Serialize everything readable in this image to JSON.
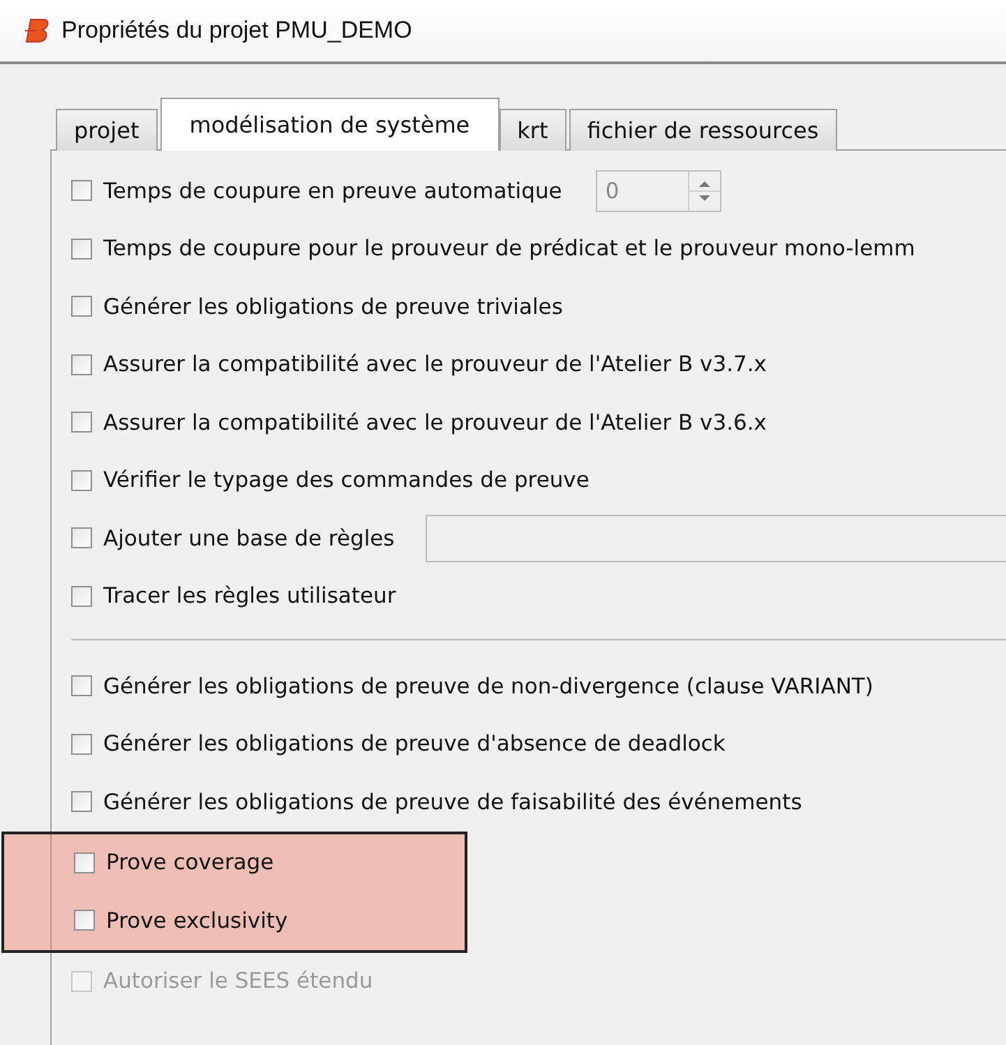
{
  "window": {
    "title": "Propriétés du projet PMU_DEMO"
  },
  "tabs": [
    {
      "label": "projet",
      "selected": false
    },
    {
      "label": "modélisation de système",
      "selected": true
    },
    {
      "label": "krt",
      "selected": false
    },
    {
      "label": "fichier de ressources",
      "selected": false
    }
  ],
  "groups": [
    {
      "options": [
        {
          "kind": "spinbox",
          "label": "Temps de coupure en preuve automatique",
          "checked": false,
          "disabled": false,
          "highlighted": false,
          "value": "0"
        },
        {
          "kind": "checkbox",
          "label": "Temps de coupure pour le prouveur de prédicat et le prouveur mono-lemm",
          "checked": false,
          "disabled": false,
          "highlighted": false
        },
        {
          "kind": "checkbox",
          "label": "Générer les obligations de preuve triviales",
          "checked": false,
          "disabled": false,
          "highlighted": false
        },
        {
          "kind": "checkbox",
          "label": "Assurer la compatibilité avec le prouveur de l'Atelier B v3.7.x",
          "checked": false,
          "disabled": false,
          "highlighted": false
        },
        {
          "kind": "checkbox",
          "label": "Assurer la compatibilité avec le prouveur de l'Atelier B v3.6.x",
          "checked": false,
          "disabled": false,
          "highlighted": false
        },
        {
          "kind": "checkbox",
          "label": "Vérifier le typage des commandes de preuve",
          "checked": false,
          "disabled": false,
          "highlighted": false
        },
        {
          "kind": "textfield",
          "label": "Ajouter une base de règles",
          "checked": false,
          "disabled": false,
          "highlighted": false
        },
        {
          "kind": "checkbox",
          "label": "Tracer les règles utilisateur",
          "checked": false,
          "disabled": false,
          "highlighted": false
        }
      ]
    },
    {
      "options": [
        {
          "kind": "checkbox",
          "label": "Générer les obligations de preuve de non-divergence (clause VARIANT)",
          "checked": false,
          "disabled": false,
          "highlighted": false
        },
        {
          "kind": "checkbox",
          "label": "Générer les obligations de preuve d'absence de deadlock",
          "checked": false,
          "disabled": false,
          "highlighted": false
        },
        {
          "kind": "checkbox",
          "label": "Générer les obligations de preuve de faisabilité des événements",
          "checked": false,
          "disabled": false,
          "highlighted": false
        },
        {
          "kind": "checkbox",
          "label": "Prove coverage",
          "checked": false,
          "disabled": false,
          "highlighted": true
        },
        {
          "kind": "checkbox",
          "label": "Prove exclusivity",
          "checked": false,
          "disabled": false,
          "highlighted": true
        },
        {
          "kind": "checkbox",
          "label": "Autoriser le SEES étendu",
          "checked": false,
          "disabled": true,
          "highlighted": false
        }
      ]
    }
  ]
}
